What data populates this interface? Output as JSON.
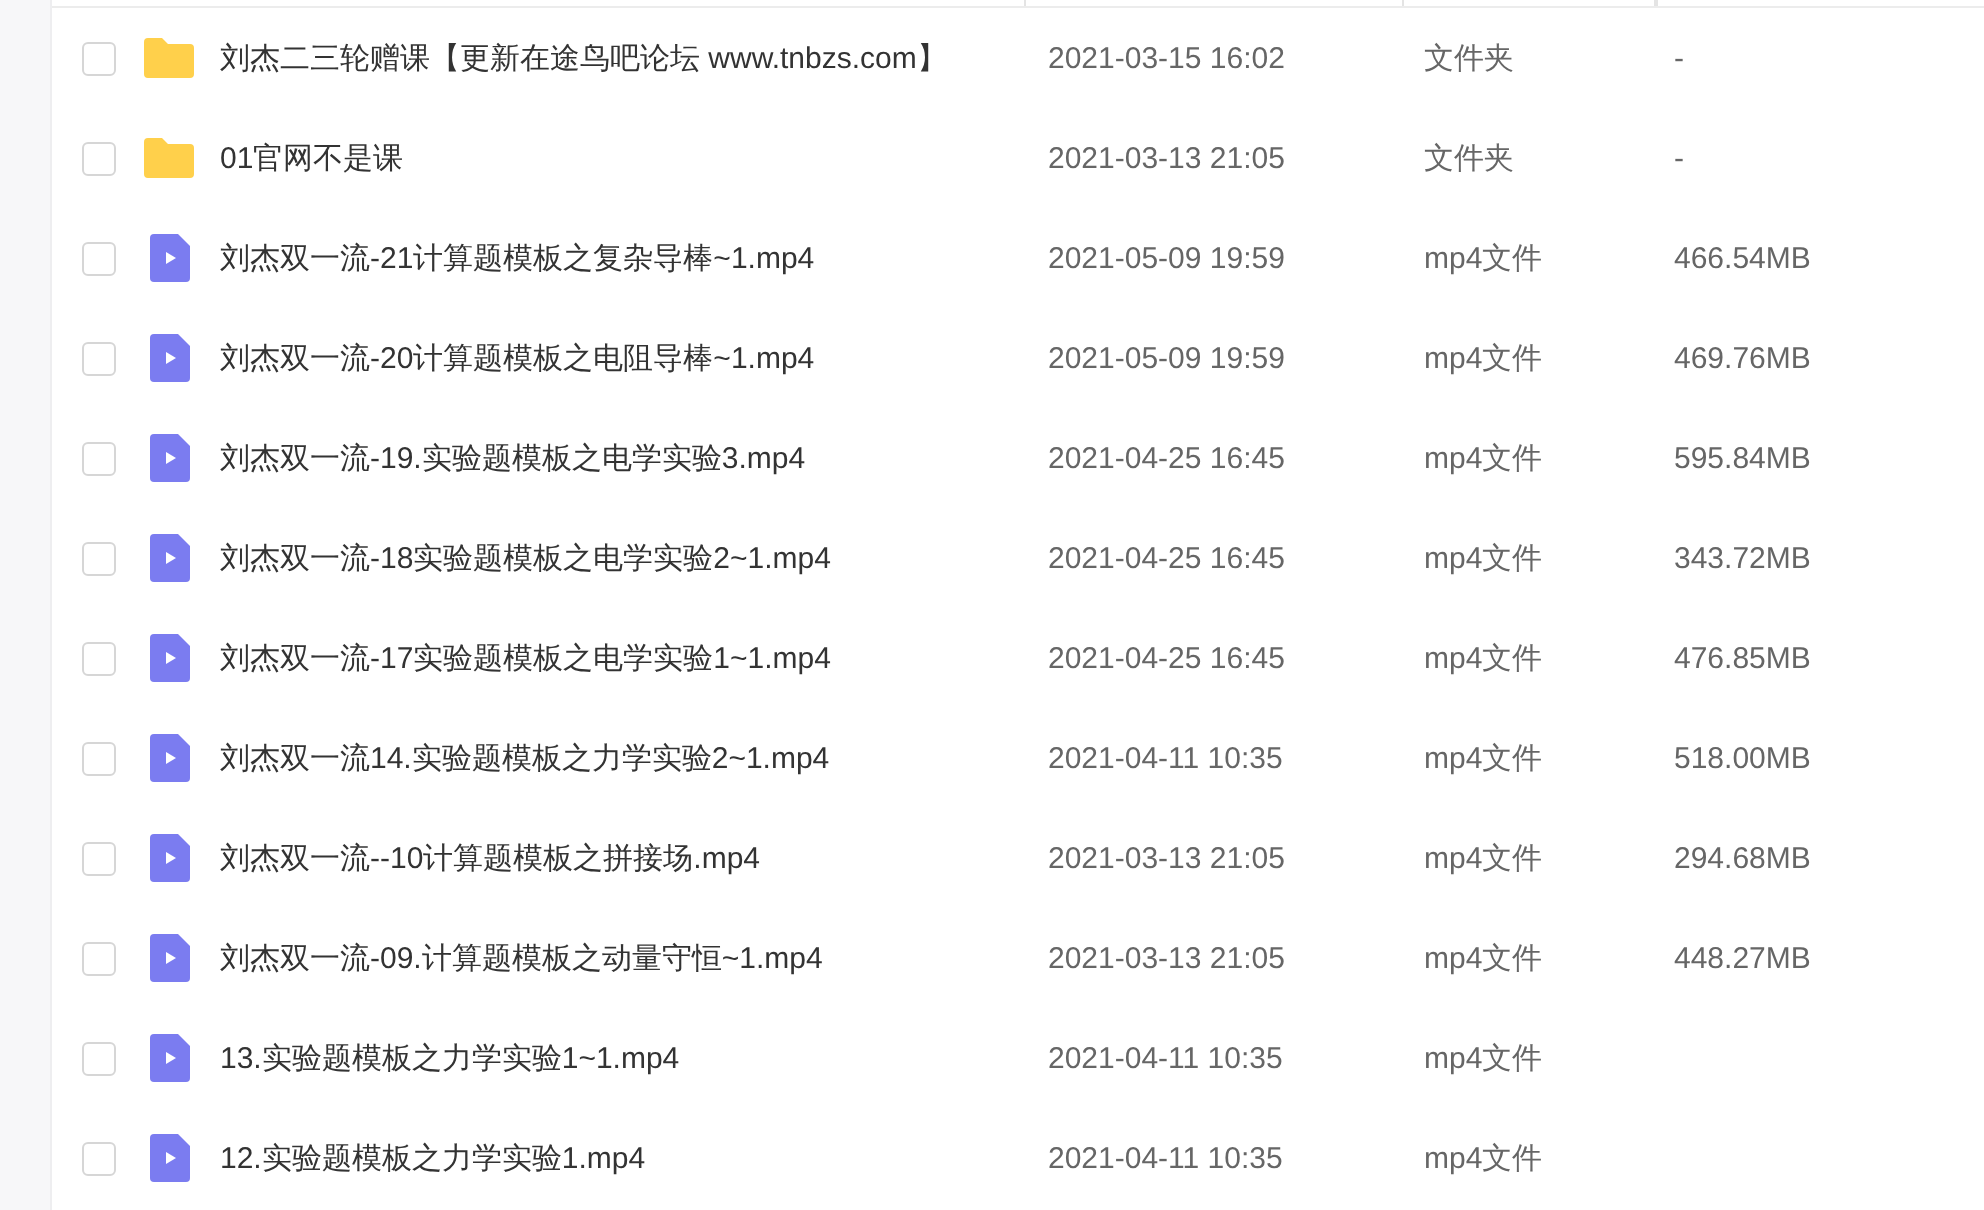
{
  "files": [
    {
      "kind": "folder",
      "name": "刘杰二三轮赠课【更新在途鸟吧论坛 www.tnbzs.com】",
      "modified": "2021-03-15 16:02",
      "type": "文件夹",
      "size": "-",
      "checked": false
    },
    {
      "kind": "folder",
      "name": "01官网不是课",
      "modified": "2021-03-13 21:05",
      "type": "文件夹",
      "size": "-",
      "checked": false
    },
    {
      "kind": "video",
      "name": "刘杰双一流-21计算题模板之复杂导棒~1.mp4",
      "modified": "2021-05-09 19:59",
      "type": "mp4文件",
      "size": "466.54MB",
      "checked": false
    },
    {
      "kind": "video",
      "name": "刘杰双一流-20计算题模板之电阻导棒~1.mp4",
      "modified": "2021-05-09 19:59",
      "type": "mp4文件",
      "size": "469.76MB",
      "checked": false
    },
    {
      "kind": "video",
      "name": "刘杰双一流-19.实验题模板之电学实验3.mp4",
      "modified": "2021-04-25 16:45",
      "type": "mp4文件",
      "size": "595.84MB",
      "checked": false
    },
    {
      "kind": "video",
      "name": "刘杰双一流-18实验题模板之电学实验2~1.mp4",
      "modified": "2021-04-25 16:45",
      "type": "mp4文件",
      "size": "343.72MB",
      "checked": false
    },
    {
      "kind": "video",
      "name": "刘杰双一流-17实验题模板之电学实验1~1.mp4",
      "modified": "2021-04-25 16:45",
      "type": "mp4文件",
      "size": "476.85MB",
      "checked": false
    },
    {
      "kind": "video",
      "name": "刘杰双一流14.实验题模板之力学实验2~1.mp4",
      "modified": "2021-04-11 10:35",
      "type": "mp4文件",
      "size": "518.00MB",
      "checked": false
    },
    {
      "kind": "video",
      "name": "刘杰双一流--10计算题模板之拼接场.mp4",
      "modified": "2021-03-13 21:05",
      "type": "mp4文件",
      "size": "294.68MB",
      "checked": false
    },
    {
      "kind": "video",
      "name": "刘杰双一流-09.计算题模板之动量守恒~1.mp4",
      "modified": "2021-03-13 21:05",
      "type": "mp4文件",
      "size": "448.27MB",
      "checked": false
    },
    {
      "kind": "video",
      "name": "13.实验题模板之力学实验1~1.mp4",
      "modified": "2021-04-11 10:35",
      "type": "mp4文件",
      "checked": false
    },
    {
      "kind": "video",
      "name": "12.实验题模板之力学实验1.mp4",
      "modified": "2021-04-11 10:35",
      "type": "mp4文件",
      "checked": false
    }
  ]
}
